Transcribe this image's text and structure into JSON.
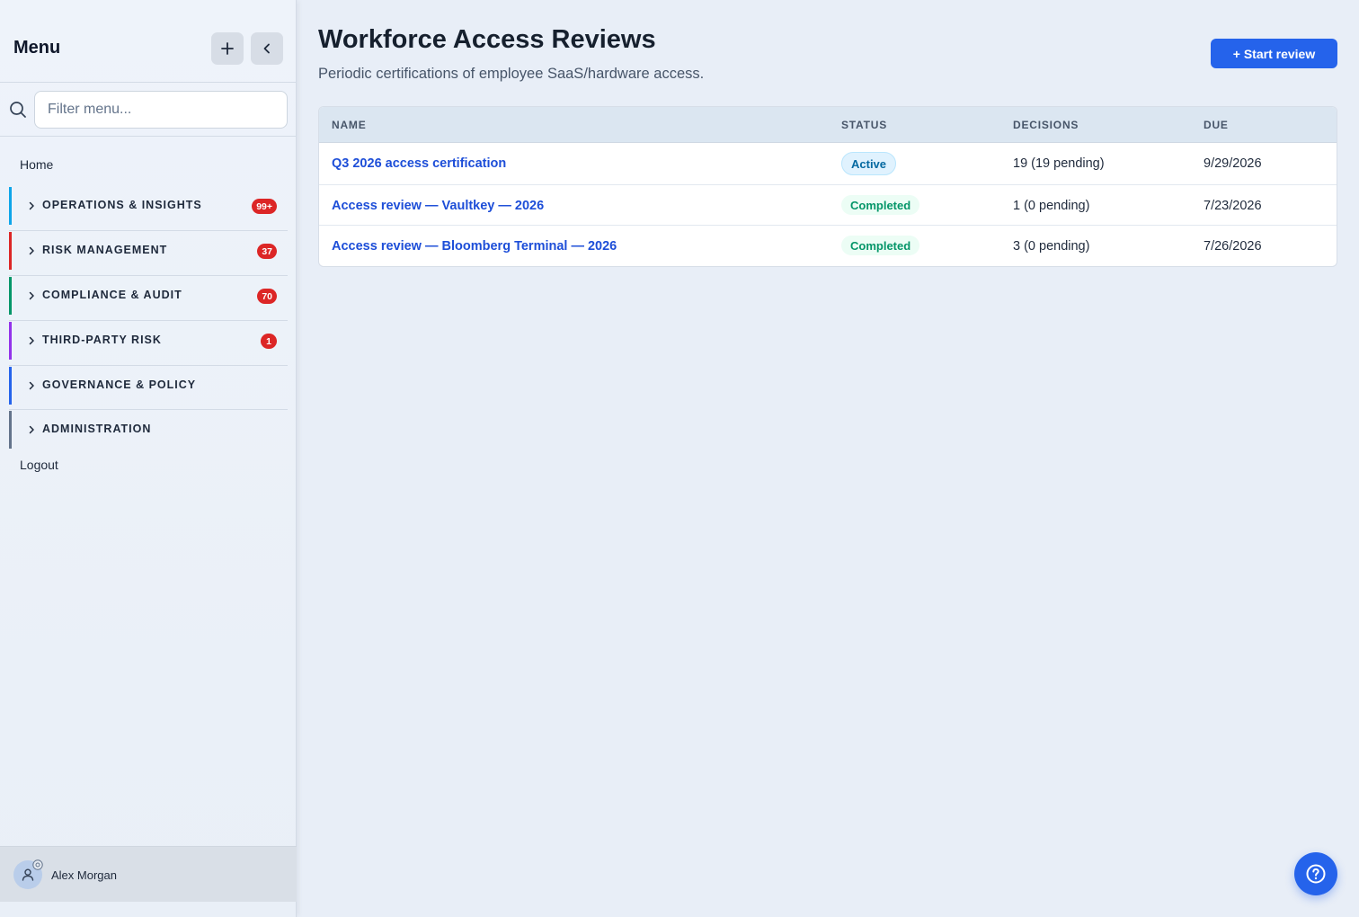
{
  "sidebar": {
    "title": "Menu",
    "filter_placeholder": "Filter menu...",
    "home_label": "Home",
    "groups": [
      {
        "label": "OPERATIONS & INSIGHTS",
        "badge": "99+",
        "color": "#0ea5e9"
      },
      {
        "label": "RISK MANAGEMENT",
        "badge": "37",
        "color": "#dc2626"
      },
      {
        "label": "COMPLIANCE & AUDIT",
        "badge": "70",
        "color": "#059669"
      },
      {
        "label": "THIRD-PARTY RISK",
        "badge": "1",
        "color": "#9333ea"
      },
      {
        "label": "GOVERNANCE & POLICY",
        "badge": "",
        "color": "#2563eb"
      },
      {
        "label": "ADMINISTRATION",
        "badge": "",
        "color": "#64748b"
      }
    ],
    "logout_label": "Logout",
    "user_name": "Alex Morgan"
  },
  "header": {
    "title": "Workforce Access Reviews",
    "subtitle": "Periodic certifications of employee SaaS/hardware access.",
    "start_button": "+ Start review"
  },
  "table": {
    "columns": [
      "NAME",
      "STATUS",
      "DECISIONS",
      "DUE"
    ],
    "rows": [
      {
        "name": "Q3 2026 access certification",
        "status": "Active",
        "decisions": "19 (19 pending)",
        "due": "9/29/2026"
      },
      {
        "name": "Access review — Vaultkey — 2026",
        "status": "Completed",
        "decisions": "1 (0 pending)",
        "due": "7/23/2026"
      },
      {
        "name": "Access review — Bloomberg Terminal — 2026",
        "status": "Completed",
        "decisions": "3 (0 pending)",
        "due": "7/26/2026"
      }
    ]
  },
  "colors": {
    "accent": "#2563eb",
    "badge": "#dc2626",
    "active_status": "#0369a1",
    "completed_status": "#059669"
  },
  "icons": {
    "add": "plus-icon",
    "collapse": "chevron-left-icon",
    "search": "search-icon",
    "group_toggle": "chevron-right-icon",
    "avatar": "user-icon",
    "avatar_badge": "gear-icon",
    "help": "question-circle-icon"
  }
}
